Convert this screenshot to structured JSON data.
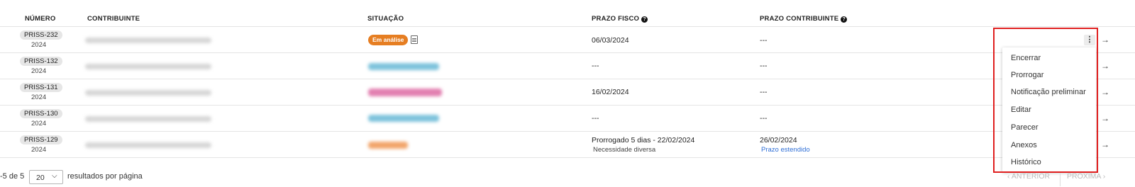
{
  "table": {
    "headers": {
      "numero": "NÚMERO",
      "contribuinte": "CONTRIBUINTE",
      "situacao": "SITUAÇÃO",
      "prazo_fisco": "PRAZO FISCO",
      "prazo_contribuinte": "PRAZO CONTRIBUINTE"
    },
    "help_icon": "?",
    "rows": [
      {
        "id": "PRISS-232",
        "year": "2024",
        "status": "Em análise",
        "prazo_fisco": "06/03/2024",
        "prazo_fisco_note": "",
        "prazo_contribuinte": "---",
        "prazo_contribuinte_note": ""
      },
      {
        "id": "PRISS-132",
        "year": "2024",
        "status": "",
        "prazo_fisco": "---",
        "prazo_fisco_note": "",
        "prazo_contribuinte": "---",
        "prazo_contribuinte_note": ""
      },
      {
        "id": "PRISS-131",
        "year": "2024",
        "status": "",
        "prazo_fisco": "16/02/2024",
        "prazo_fisco_note": "",
        "prazo_contribuinte": "---",
        "prazo_contribuinte_note": ""
      },
      {
        "id": "PRISS-130",
        "year": "2024",
        "status": "",
        "prazo_fisco": "---",
        "prazo_fisco_note": "",
        "prazo_contribuinte": "---",
        "prazo_contribuinte_note": ""
      },
      {
        "id": "PRISS-129",
        "year": "2024",
        "status": "",
        "prazo_fisco": "Prorrogado 5 dias - 22/02/2024",
        "prazo_fisco_note": "Necessidade diversa",
        "prazo_contribuinte": "26/02/2024",
        "prazo_contribuinte_note": "Prazo estendido"
      }
    ],
    "status_colors": {
      "em_analise": "#e67e22",
      "blue": "#7ec3dc",
      "pink": "#e27fb0",
      "orange": "#f2a56b"
    }
  },
  "actions_menu": {
    "kebab_icon": "⋮",
    "items": [
      "Encerrar",
      "Prorrogar",
      "Notificação preliminar",
      "Editar",
      "Parecer",
      "Anexos",
      "Histórico"
    ]
  },
  "row_arrow_icon": "→",
  "footer": {
    "range_text": "-5 de 5",
    "per_page_value": "20",
    "per_page_label": "resultados por página",
    "prev_label": "‹ ANTERIOR",
    "next_label": "PRÓXIMA ›"
  },
  "highlight_color": "#e01f1f"
}
